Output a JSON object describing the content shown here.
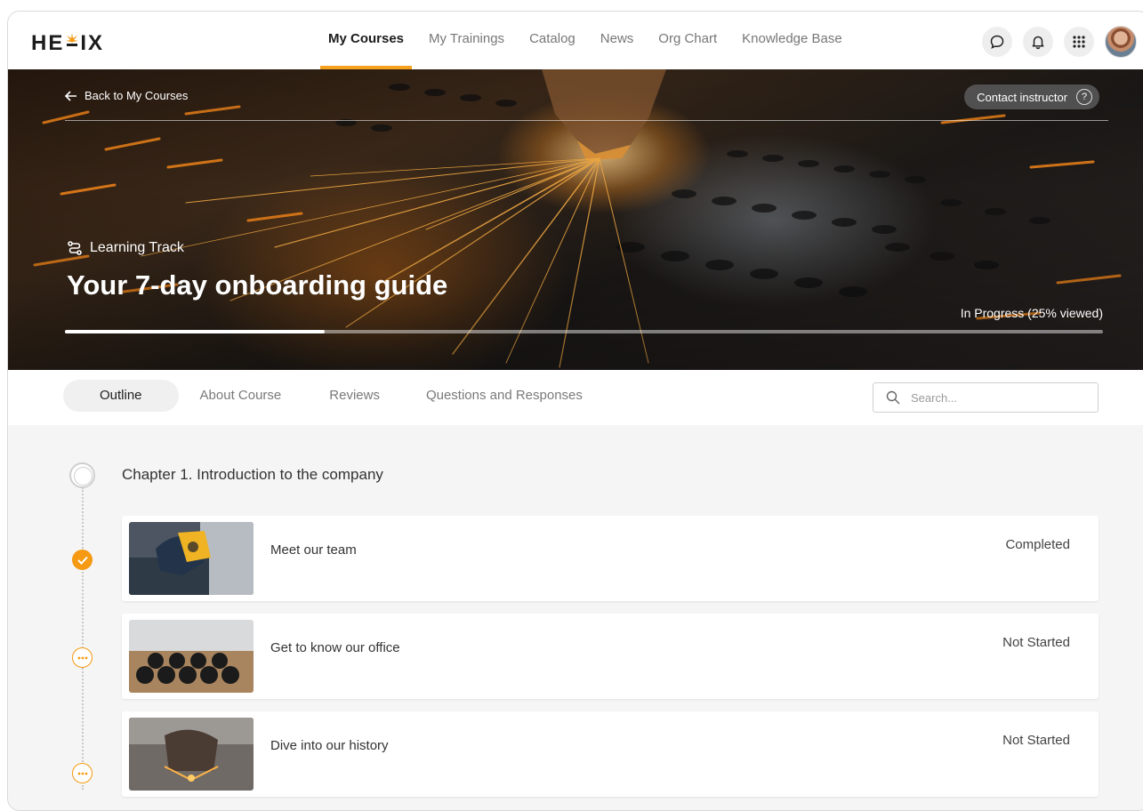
{
  "brand": {
    "logo_text_left": "HE",
    "logo_text_right": "IX",
    "accent": "#f59a12"
  },
  "nav": {
    "links": [
      {
        "label": "My Courses",
        "active": true
      },
      {
        "label": "My Trainings"
      },
      {
        "label": "Catalog"
      },
      {
        "label": "News"
      },
      {
        "label": "Org Chart"
      },
      {
        "label": "Knowledge Base"
      }
    ],
    "icons": [
      "chat-icon",
      "bell-icon",
      "apps-grid-icon",
      "user-avatar"
    ]
  },
  "hero": {
    "back_label": "Back to My Courses",
    "contact_label": "Contact instructor",
    "contact_help": "?",
    "track_label": "Learning Track",
    "course_title": "Your 7-day onboarding guide",
    "progress_label": "In Progress (25% viewed)",
    "progress_fraction": 0.25
  },
  "tabs": [
    {
      "label": "Outline",
      "active": true
    },
    {
      "label": "About Course"
    },
    {
      "label": "Reviews"
    },
    {
      "label": "Questions and Responses"
    }
  ],
  "search": {
    "placeholder": "Search..."
  },
  "outline": {
    "chapter_title": "Chapter 1. Introduction to the company",
    "lessons": [
      {
        "title": "Meet our team",
        "status": "Completed",
        "state": "done"
      },
      {
        "title": "Get to know our office",
        "status": "Not Started",
        "state": "todo"
      },
      {
        "title": "Dive into our history",
        "status": "Not Started",
        "state": "todo"
      }
    ]
  }
}
